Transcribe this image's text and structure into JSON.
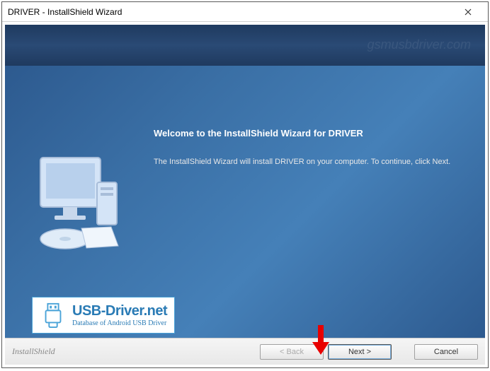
{
  "window": {
    "title": "DRIVER - InstallShield Wizard"
  },
  "watermark": "gsmusbdriver.com",
  "content": {
    "heading": "Welcome to the InstallShield Wizard for DRIVER",
    "body": "The InstallShield Wizard will install DRIVER on your computer.  To continue, click Next."
  },
  "logo": {
    "title": "USB-Driver.net",
    "subtitle": "Database of Android USB Driver"
  },
  "footer": {
    "brand": "InstallShield",
    "back": "< Back",
    "next": "Next >",
    "cancel": "Cancel"
  }
}
